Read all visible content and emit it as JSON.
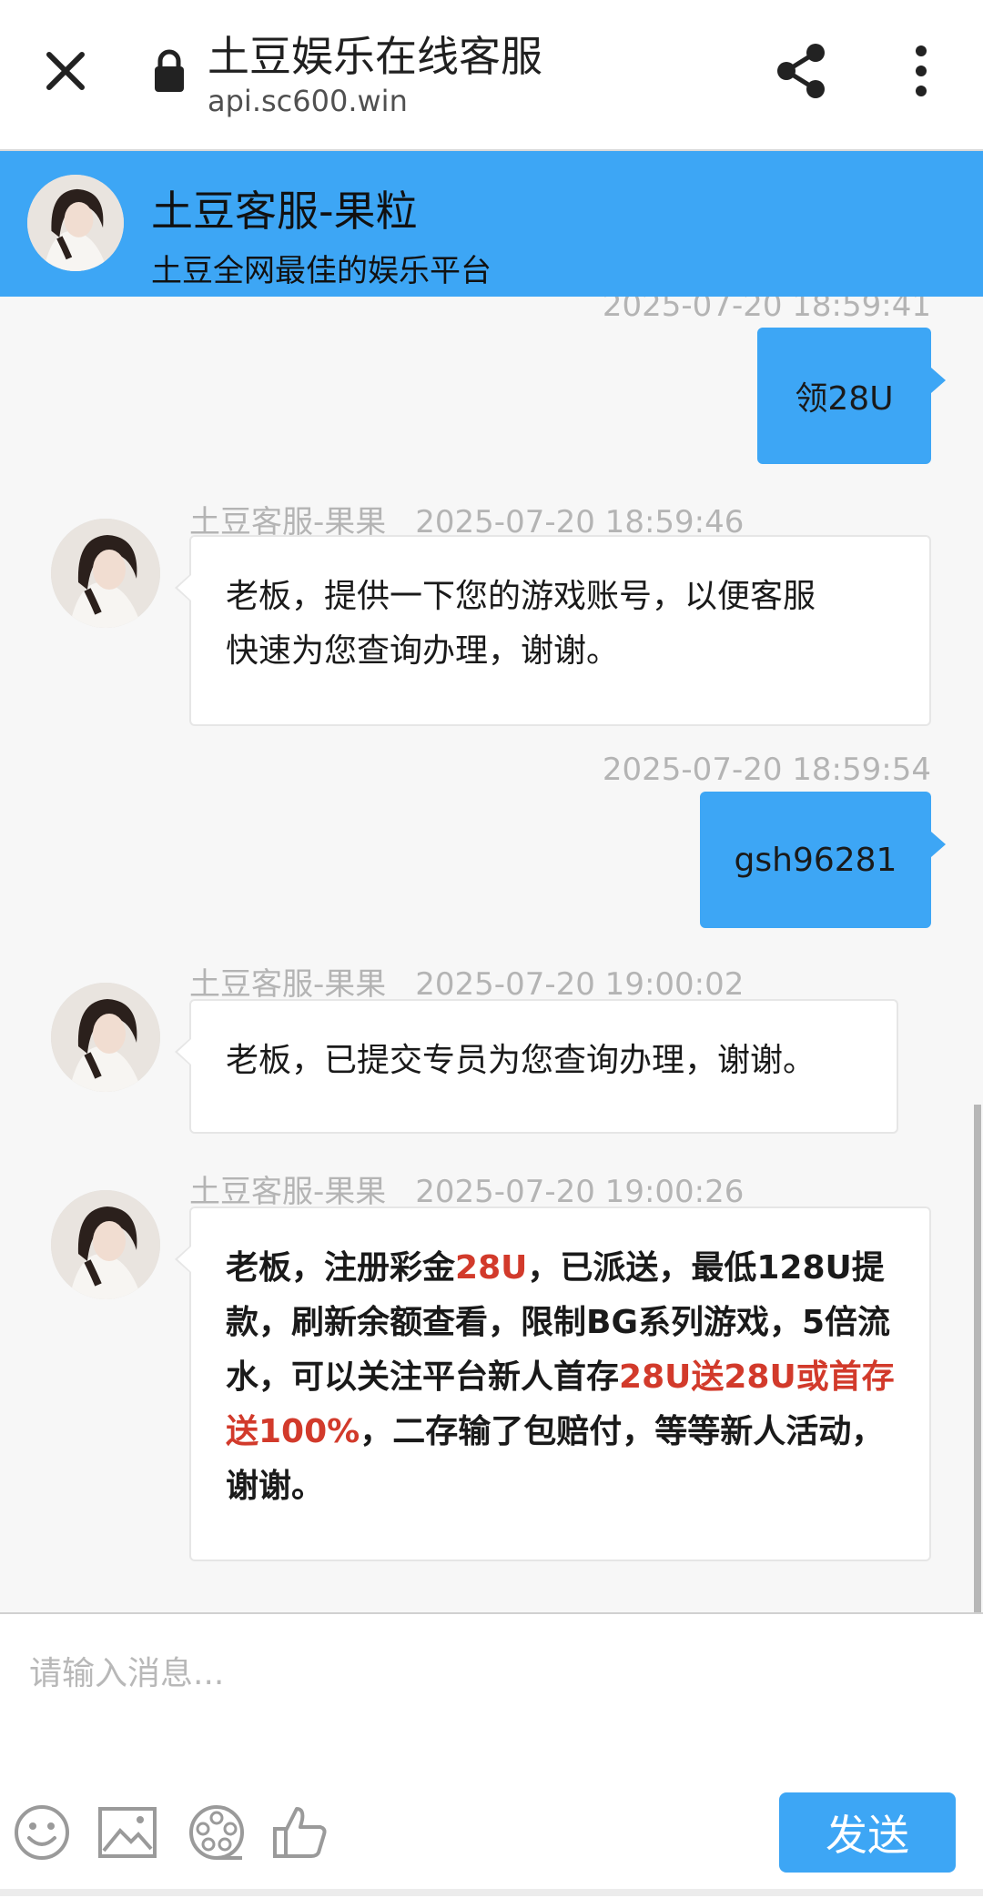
{
  "browser": {
    "title": "土豆娱乐在线客服",
    "url": "api.sc600.win",
    "icons": {
      "close": "close-icon",
      "lock": "lock-icon",
      "share": "share-icon",
      "more": "more-vert-icon"
    }
  },
  "header": {
    "agent_name": "土豆客服-果粒",
    "slogan": "土豆全网最佳的娱乐平台"
  },
  "messages": [
    {
      "side": "out",
      "time": "2025-07-20 18:59:41",
      "text": "领28U"
    },
    {
      "side": "in",
      "sender": "土豆客服-果果",
      "time": "2025-07-20 18:59:46",
      "lines": [
        "老板，提供一下您的游戏账号，以便客服",
        "快速为您查询办理，谢谢。"
      ]
    },
    {
      "side": "out",
      "time": "2025-07-20 18:59:54",
      "text": "gsh96281"
    },
    {
      "side": "in",
      "sender": "土豆客服-果果",
      "time": "2025-07-20 19:00:02",
      "lines": [
        "老板，已提交专员为您查询办理，谢谢。"
      ]
    },
    {
      "side": "in",
      "sender": "土豆客服-果果",
      "time": "2025-07-20 19:00:26",
      "rich_segments": [
        {
          "text": "老板，注册彩金",
          "highlight": false
        },
        {
          "text": "28U",
          "highlight": true
        },
        {
          "text": "，已派送，最低128U提款，刷新余额查看，限制BG系列游戏，5倍流水，可以关注平台新人首存",
          "highlight": false
        },
        {
          "text": "28U送28U或首存送100%",
          "highlight": true
        },
        {
          "text": "，二存输了包赔付，等等新人活动，谢谢。",
          "highlight": false
        }
      ]
    }
  ],
  "input": {
    "placeholder": "请输入消息..."
  },
  "toolbar": {
    "tools": [
      "emoji-icon",
      "image-icon",
      "film-reel-icon",
      "thumbs-up-icon"
    ],
    "send_label": "发送"
  },
  "colors": {
    "accent": "#3da6f5",
    "highlight": "#d23a2b",
    "timestamp": "#b4b4b4",
    "background": "#f7f7f7"
  }
}
